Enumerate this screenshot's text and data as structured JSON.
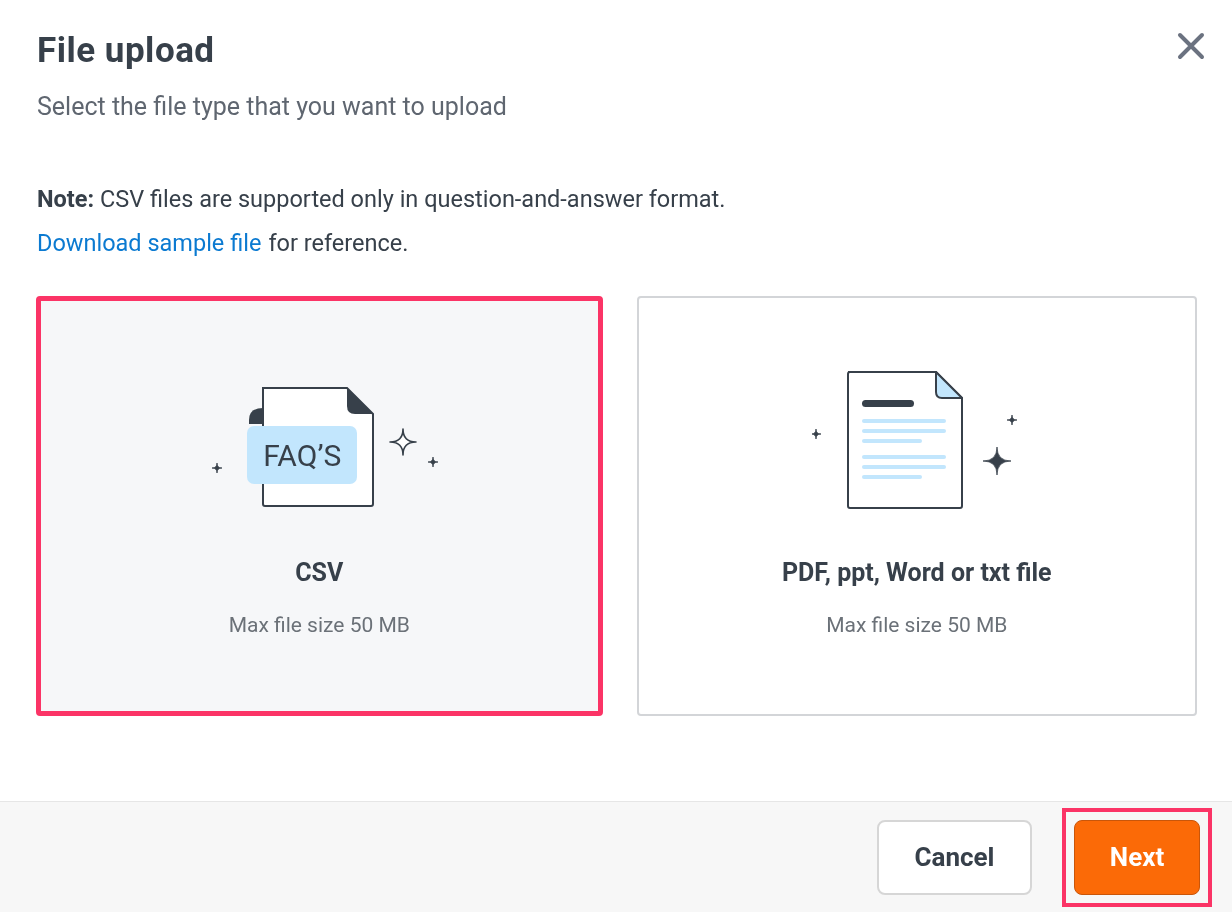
{
  "dialog": {
    "title": "File upload",
    "subtitle": "Select the file type that you want to upload"
  },
  "note": {
    "label": "Note:",
    "text": "CSV files are supported only in question-and-answer format.",
    "link": "Download sample file",
    "link_suffix": "for reference."
  },
  "options": [
    {
      "kind": "faq",
      "icon_text": "FAQ’S",
      "title": "CSV",
      "caption": "Max file size 50 MB",
      "selected": true
    },
    {
      "kind": "document",
      "title": "PDF, ppt, Word or txt file",
      "caption": "Max file size 50 MB",
      "selected": false
    }
  ],
  "buttons": [
    {
      "kind": "secondary",
      "label": "Cancel",
      "highlighted": false
    },
    {
      "kind": "primary",
      "label": "Next",
      "highlighted": true
    }
  ]
}
